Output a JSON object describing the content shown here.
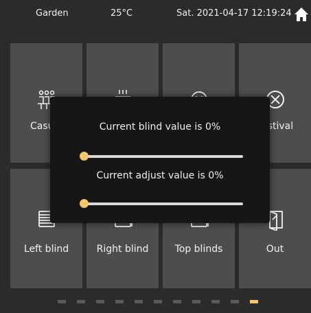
{
  "statusbar": {
    "room": "Garden",
    "temperature": "25°C",
    "datetime": "Sat. 2021-04-17 12:19:24",
    "home_icon": "home-icon"
  },
  "tiles": {
    "row1": [
      {
        "label": "Casual",
        "icon": "casual-people-icon"
      },
      {
        "label": "",
        "icon": "coffee-icon"
      },
      {
        "label": "",
        "icon": "smiley-icon"
      },
      {
        "label": "Festival",
        "icon": "festival-icon"
      }
    ],
    "row2": [
      {
        "label": "Left blind",
        "icon": "blind-icon"
      },
      {
        "label": "Right blind",
        "icon": "blind-icon"
      },
      {
        "label": "Top blinds",
        "icon": "blind-icon"
      },
      {
        "label": "Out",
        "icon": "door-out-icon"
      }
    ]
  },
  "dialog": {
    "blind_message": "Current blind value is 0%",
    "blind_value": 0,
    "adjust_message": "Current adjust value is 0%",
    "adjust_value": 0
  },
  "pager": {
    "count": 11,
    "active_index": 10
  },
  "colors": {
    "accent": "#f2c66d",
    "tile": "#4d4d4d",
    "background": "#2b2b2b",
    "dialog": "#161616"
  }
}
